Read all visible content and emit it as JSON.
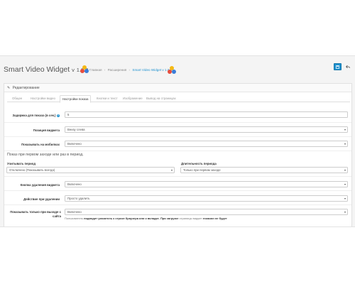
{
  "header": {
    "title": "Smart Video Widget",
    "version_prefix": "v",
    "version": "1.0.0",
    "breadcrumb": {
      "home": "Главная",
      "separator": "›",
      "extensions": "Расширения",
      "current": "Smart Video Widget v 1.0.0"
    },
    "save_icon": "save-icon",
    "back_icon": "reply-icon"
  },
  "panel": {
    "heading": "Редактирование",
    "pencil_glyph": "✎",
    "tabs": [
      {
        "label": "Общее"
      },
      {
        "label": "Настройки видео"
      },
      {
        "label": "Настройки показа"
      },
      {
        "label": "Кнопки и текст"
      },
      {
        "label": "Изображение"
      },
      {
        "label": "Вывод на страницах"
      }
    ]
  },
  "form": {
    "delay": {
      "label": "Задержка для показа (в сек.)",
      "value": "5"
    },
    "position": {
      "label": "Позиция виджета",
      "value": "Внизу слева"
    },
    "mobile": {
      "label": "Показывать на мобилках",
      "value": "Включено"
    },
    "section_title": "Показ при первом заходе или раз в период.",
    "period": {
      "label": "Учитывать период",
      "value": "Отключено (Показывать всегда)"
    },
    "duration": {
      "label": "Длительность периода",
      "value": "Только при первом заходе"
    },
    "remove_buttons": {
      "label": "Кнопка удаления виджета",
      "value": "Включено"
    },
    "on_delete": {
      "label": "Действие при удалении",
      "value": "Просто удалить"
    },
    "exit_only": {
      "label": "Показывать только при выходе с сайта",
      "value": "Включено"
    },
    "help": {
      "part1": "Пользователь",
      "part2": "подводит указатель к строке браузера или к вкладке. При загрузке",
      "part3": "страницы виджет",
      "part4": "показан не будет"
    }
  },
  "colors": {
    "accent": "#1e91cf",
    "logo_red": "#e74c3c",
    "logo_yellow": "#f5b914",
    "logo_blue": "#3b7dd8"
  }
}
